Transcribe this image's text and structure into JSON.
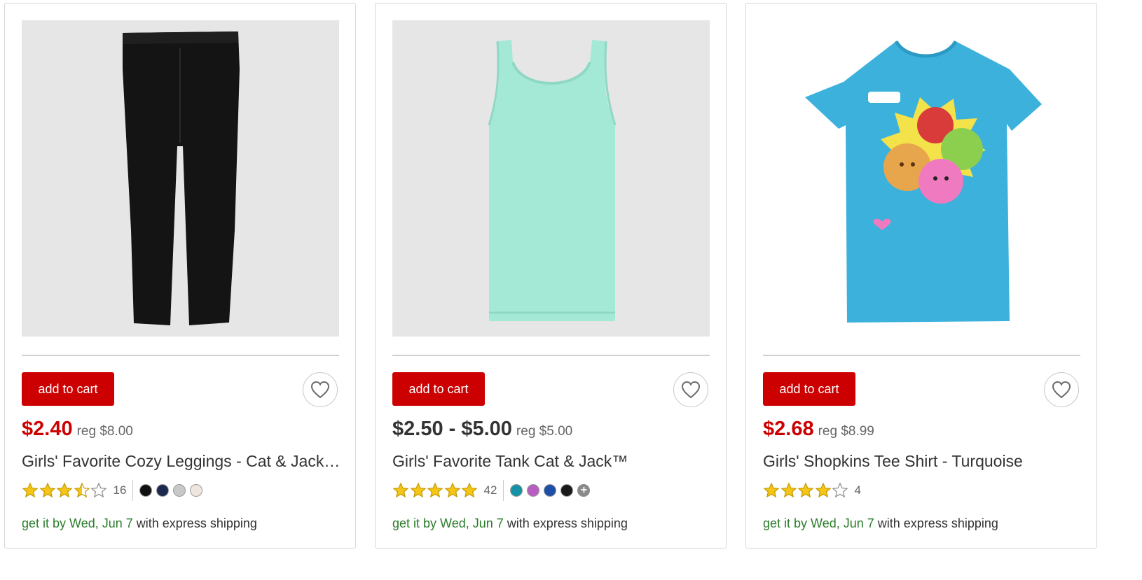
{
  "colors": {
    "brand_red": "#cc0000",
    "star_gold": "#f5c518",
    "shipping_green": "#2b7d2b"
  },
  "products": [
    {
      "image_icon": "black-leggings-image",
      "add_to_cart_label": "add to cart",
      "favorite_icon": "heart-outline-icon",
      "price": "$2.40",
      "reg_price": "reg $8.00",
      "title": "Girls' Favorite Cozy Leggings - Cat & Jack™ Black",
      "rating": 3.5,
      "review_count": "16",
      "swatches": [
        "#111111",
        "#1c2a4f",
        "#c8c8c8",
        "#efe7df"
      ],
      "has_more_swatches": false,
      "ship_date": "get it by Wed, Jun 7",
      "ship_suffix": "with express shipping"
    },
    {
      "image_icon": "mint-tank-top-image",
      "add_to_cart_label": "add to cart",
      "favorite_icon": "heart-outline-icon",
      "price": "$2.50 - $5.00",
      "reg_price": "reg $5.00",
      "title": "Girls' Favorite Tank Cat & Jack™",
      "rating": 5,
      "review_count": "42",
      "swatches": [
        "#1592a6",
        "#b65fc0",
        "#1d4fa8",
        "#1a1a1a"
      ],
      "has_more_swatches": true,
      "more_icon": "plus-icon",
      "ship_date": "get it by Wed, Jun 7",
      "ship_suffix": "with express shipping"
    },
    {
      "image_icon": "turquoise-shopkins-tee-image",
      "add_to_cart_label": "add to cart",
      "favorite_icon": "heart-outline-icon",
      "price": "$2.68",
      "reg_price": "reg $8.99",
      "title": "Girls' Shopkins Tee Shirt - Turquoise",
      "rating": 4,
      "review_count": "4",
      "swatches": [],
      "has_more_swatches": false,
      "ship_date": "get it by Wed, Jun 7",
      "ship_suffix": "with express shipping"
    }
  ]
}
